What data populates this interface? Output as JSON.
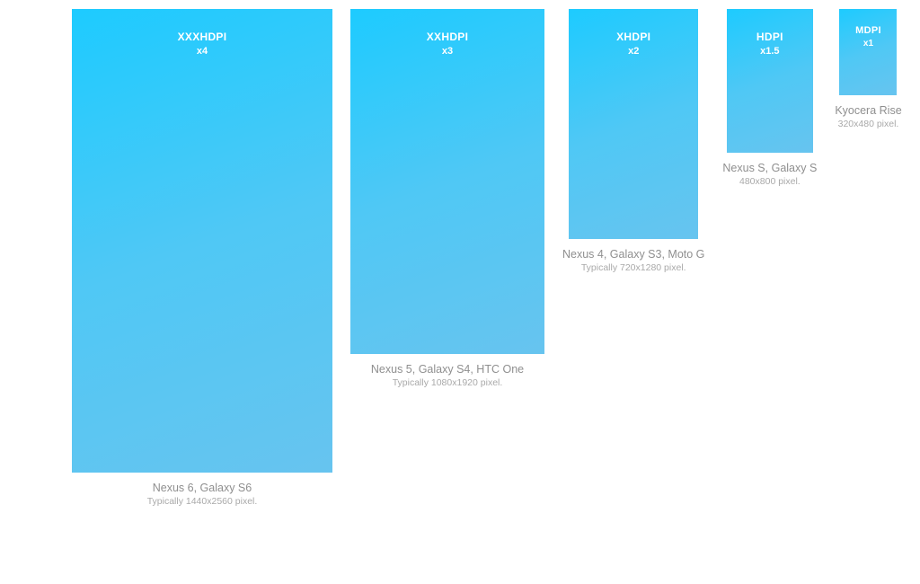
{
  "densities": [
    {
      "id": "xxxhdpi",
      "label": "XXXHDPI",
      "multiplier": "x4",
      "devices": "Nexus 6, Galaxy S6",
      "resolution": "Typically 1440x2560 pixel."
    },
    {
      "id": "xxhdpi",
      "label": "XXHDPI",
      "multiplier": "x3",
      "devices": "Nexus 5, Galaxy S4, HTC One",
      "resolution": "Typically 1080x1920 pixel."
    },
    {
      "id": "xhdpi",
      "label": "XHDPI",
      "multiplier": "x2",
      "devices": "Nexus 4, Galaxy S3, Moto G",
      "resolution": "Typically 720x1280 pixel."
    },
    {
      "id": "hdpi",
      "label": "HDPI",
      "multiplier": "x1.5",
      "devices": "Nexus S, Galaxy S",
      "resolution": "480x800 pixel."
    },
    {
      "id": "mdpi",
      "label": "MDPI",
      "multiplier": "x1",
      "devices": "Kyocera Rise",
      "resolution": "320x480 pixel."
    }
  ]
}
